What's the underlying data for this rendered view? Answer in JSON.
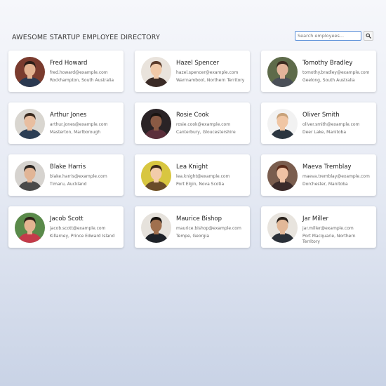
{
  "header": {
    "title": "AWESOME STARTUP EMPLOYEE DIRECTORY",
    "search_placeholder": "Search employees...",
    "search_value": ""
  },
  "icons": {
    "search": "magnifier-icon"
  },
  "employees": [
    {
      "name": "Fred Howard",
      "email": "fred.howard@example.com",
      "location": "Rockhampton, South Australia",
      "avatar": {
        "bg": "#7a3b2e",
        "skin": "#e3b291",
        "hair": "#2b1d17",
        "shirt": "#2a3850"
      }
    },
    {
      "name": "Hazel Spencer",
      "email": "hazel.spencer@example.com",
      "location": "Warrnambool, Northern Territory",
      "avatar": {
        "bg": "#e9e3dc",
        "skin": "#f0c9a8",
        "hair": "#5a3a2a",
        "shirt": "#3a2b26"
      }
    },
    {
      "name": "Tomothy Bradley",
      "email": "tomothy.bradley@example.com",
      "location": "Geelong, South Australia",
      "avatar": {
        "bg": "#5e6b4a",
        "skin": "#e2b49a",
        "hair": "#3b2a20",
        "shirt": "#4a4f57"
      }
    },
    {
      "name": "Arthur Jones",
      "email": "arthur.jones@example.com",
      "location": "Masterton, Marlborough",
      "avatar": {
        "bg": "#d9d6d0",
        "skin": "#e8bea0",
        "hair": "#3a2a1e",
        "shirt": "#2c3e54"
      }
    },
    {
      "name": "Rosie Cook",
      "email": "rosie.cook@example.com",
      "location": "Canterbury, Gloucestershire",
      "avatar": {
        "bg": "#2a2326",
        "skin": "#8a5a44",
        "hair": "#1a1412",
        "shirt": "#5a2e3a"
      }
    },
    {
      "name": "Oliver Smith",
      "email": "oliver.smith@example.com",
      "location": "Deer Lake, Manitoba",
      "avatar": {
        "bg": "#f2f2f2",
        "skin": "#f0c6a4",
        "hair": "#c8a27a",
        "shirt": "#2c3640"
      }
    },
    {
      "name": "Blake Harris",
      "email": "blake.harris@example.com",
      "location": "Timaru, Auckland",
      "avatar": {
        "bg": "#d6d3cf",
        "skin": "#e1b596",
        "hair": "#2a2420",
        "shirt": "#4a4a4a"
      }
    },
    {
      "name": "Lea Knight",
      "email": "lea.knight@example.com",
      "location": "Port Elgin, Nova Scotia",
      "avatar": {
        "bg": "#d8c640",
        "skin": "#f2ccaa",
        "hair": "#3b2818",
        "shirt": "#6a4c2a"
      }
    },
    {
      "name": "Maeva Tremblay",
      "email": "maeva.tremblay@example.com",
      "location": "Dorchester, Manitoba",
      "avatar": {
        "bg": "#7a5d4e",
        "skin": "#f0c2a4",
        "hair": "#5a2a1a",
        "shirt": "#3a2a2a"
      }
    },
    {
      "name": "Jacob Scott",
      "email": "jacob.scott@example.com",
      "location": "Killarney, Prince Edward Island",
      "avatar": {
        "bg": "#5a8a4a",
        "skin": "#e4b492",
        "hair": "#2a1e16",
        "shirt": "#c43a4a"
      }
    },
    {
      "name": "Maurice Bishop",
      "email": "maurice.bishop@example.com",
      "location": "Tempe, Georgia",
      "avatar": {
        "bg": "#e6e2dc",
        "skin": "#a0704e",
        "hair": "#15110e",
        "shirt": "#1e2228"
      }
    },
    {
      "name": "Jar Miller",
      "email": "jar.miller@example.com",
      "location": "Port Macquarie, Northern Territory",
      "avatar": {
        "bg": "#e8e4de",
        "skin": "#e2b898",
        "hair": "#2a221c",
        "shirt": "#2a3038"
      }
    }
  ]
}
